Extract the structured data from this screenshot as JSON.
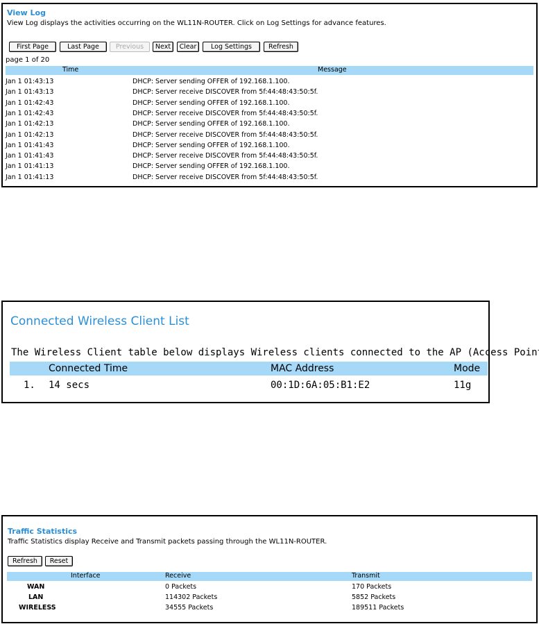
{
  "view_log": {
    "title": "View Log",
    "description": "View Log displays the activities occurring on the WL11N-ROUTER. Click on Log Settings for advance features.",
    "buttons": {
      "first_page": "First Page",
      "last_page": "Last Page",
      "previous": "Previous",
      "next": "Next",
      "clear": "Clear",
      "log_settings": "Log Settings",
      "refresh": "Refresh"
    },
    "page_info": "page 1 of 20",
    "columns": {
      "time": "Time",
      "message": "Message"
    },
    "rows": [
      {
        "time": "Jan 1 01:43:13",
        "message": "DHCP: Server sending OFFER of 192.168.1.100."
      },
      {
        "time": "Jan 1 01:43:13",
        "message": "DHCP: Server receive DISCOVER from 5f:44:48:43:50:5f."
      },
      {
        "time": "Jan 1 01:42:43",
        "message": "DHCP: Server sending OFFER of 192.168.1.100."
      },
      {
        "time": "Jan 1 01:42:43",
        "message": "DHCP: Server receive DISCOVER from 5f:44:48:43:50:5f."
      },
      {
        "time": "Jan 1 01:42:13",
        "message": "DHCP: Server sending OFFER of 192.168.1.100."
      },
      {
        "time": "Jan 1 01:42:13",
        "message": "DHCP: Server receive DISCOVER from 5f:44:48:43:50:5f."
      },
      {
        "time": "Jan 1 01:41:43",
        "message": "DHCP: Server sending OFFER of 192.168.1.100."
      },
      {
        "time": "Jan 1 01:41:43",
        "message": "DHCP: Server receive DISCOVER from 5f:44:48:43:50:5f."
      },
      {
        "time": "Jan 1 01:41:13",
        "message": "DHCP: Server sending OFFER of 192.168.1.100."
      },
      {
        "time": "Jan 1 01:41:13",
        "message": "DHCP: Server receive DISCOVER from 5f:44:48:43:50:5f."
      }
    ]
  },
  "wireless_clients": {
    "title": "Connected Wireless Client List",
    "description": "The Wireless Client table below displays Wireless clients connected to the AP (Access Point).",
    "columns": {
      "connected_time": "Connected Time",
      "mac_address": "MAC Address",
      "mode": "Mode"
    },
    "rows": [
      {
        "index": "1.",
        "connected_time": "14 secs",
        "mac_address": "00:1D:6A:05:B1:E2",
        "mode": "11g"
      }
    ]
  },
  "traffic_stats": {
    "title": "Traffic Statistics",
    "description": "Traffic Statistics display Receive and Transmit packets passing through the WL11N-ROUTER.",
    "buttons": {
      "refresh": "Refresh",
      "reset": "Reset"
    },
    "columns": {
      "interface": "Interface",
      "receive": "Receive",
      "transmit": "Transmit"
    },
    "rows": [
      {
        "interface": "WAN",
        "receive": "0 Packets",
        "transmit": "170 Packets"
      },
      {
        "interface": "LAN",
        "receive": "114302 Packets",
        "transmit": "5852 Packets"
      },
      {
        "interface": "WIRELESS",
        "receive": "34555 Packets",
        "transmit": "189511 Packets"
      }
    ]
  },
  "colors": {
    "title_blue": "#2a8fd6",
    "header_bg": "#a6d8f7",
    "disabled_text": "#aaaaaa"
  }
}
